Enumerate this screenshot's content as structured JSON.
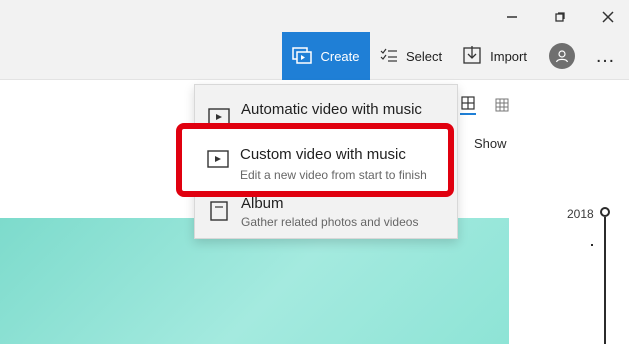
{
  "toolbar": {
    "create_label": "Create",
    "select_label": "Select",
    "import_label": "Import"
  },
  "view": {
    "show_label": "Show"
  },
  "timeline": {
    "year": "2018"
  },
  "menu": {
    "items": [
      {
        "title": "Automatic video with music",
        "description": ""
      },
      {
        "title": "Custom video with music",
        "description": "Edit a new video from start to finish"
      },
      {
        "title": "Album",
        "description": "Gather related photos and videos"
      }
    ]
  },
  "colors": {
    "accent": "#1f7fd6",
    "highlight": "#e0000f",
    "preview_teal": "#a4eadf"
  },
  "icons": {
    "minimize": "minimize-icon",
    "restore": "restore-icon",
    "close": "close-icon",
    "create": "create-icon",
    "select": "select-list-icon",
    "import": "import-icon",
    "profile": "profile-icon",
    "more": "more-icon",
    "grid_large": "grid-large-icon",
    "grid_small": "grid-small-icon",
    "filter": "chevron-down-icon",
    "video": "video-icon",
    "album": "album-icon"
  }
}
